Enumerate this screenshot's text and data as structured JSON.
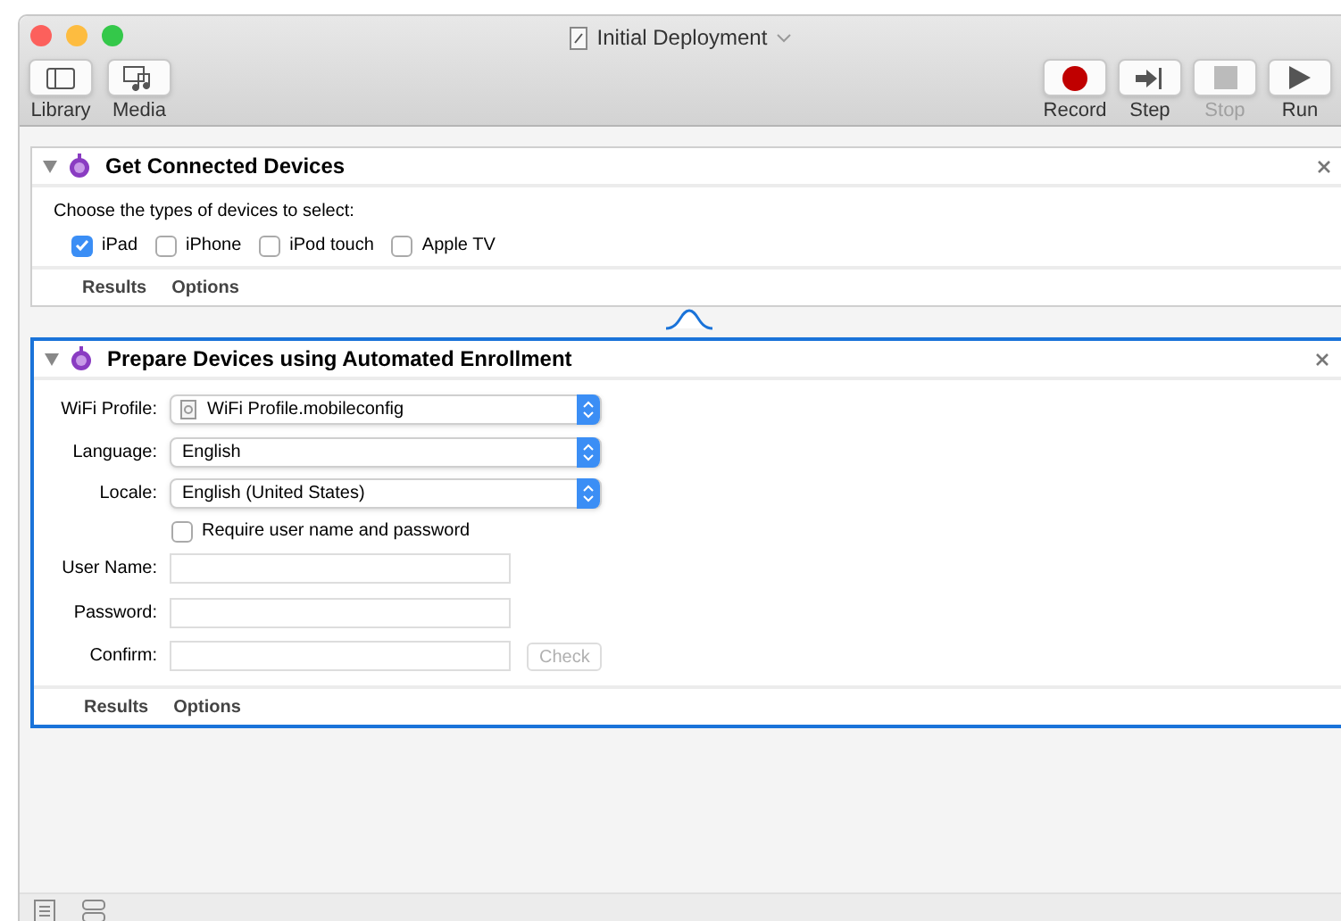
{
  "window": {
    "title": "Initial Deployment"
  },
  "toolbar_left": [
    {
      "kind": "library",
      "label": "Library"
    },
    {
      "kind": "media",
      "label": "Media"
    }
  ],
  "toolbar_right": [
    {
      "kind": "record",
      "label": "Record",
      "disabled": false
    },
    {
      "kind": "step",
      "label": "Step",
      "disabled": false
    },
    {
      "kind": "stop",
      "label": "Stop",
      "disabled": true
    },
    {
      "kind": "run",
      "label": "Run",
      "disabled": false
    }
  ],
  "actions": [
    {
      "title": "Get Connected Devices",
      "selected": false,
      "expanded": true,
      "kind": "devices",
      "prompt": "Choose the types of devices to select:",
      "devices": [
        {
          "label": "iPad",
          "checked": true
        },
        {
          "label": "iPhone",
          "checked": false
        },
        {
          "label": "iPod touch",
          "checked": false
        },
        {
          "label": "Apple TV",
          "checked": false
        }
      ],
      "footer": [
        "Results",
        "Options"
      ]
    },
    {
      "title": "Prepare Devices using Automated Enrollment",
      "selected": true,
      "expanded": true,
      "kind": "enrollment",
      "popups": [
        {
          "label": "WiFi Profile:",
          "value": "WiFi Profile.mobileconfig",
          "file_icon": true
        },
        {
          "label": "Language:",
          "value": "English",
          "file_icon": false
        },
        {
          "label": "Locale:",
          "value": "English (United States)",
          "file_icon": false
        }
      ],
      "require": {
        "label": "Require user name and password",
        "checked": false
      },
      "fields": [
        {
          "label": "User Name:"
        },
        {
          "label": "Password:"
        },
        {
          "label": "Confirm:"
        }
      ],
      "check_button": {
        "label": "Check",
        "disabled": true
      },
      "footer": [
        "Results",
        "Options"
      ]
    }
  ]
}
